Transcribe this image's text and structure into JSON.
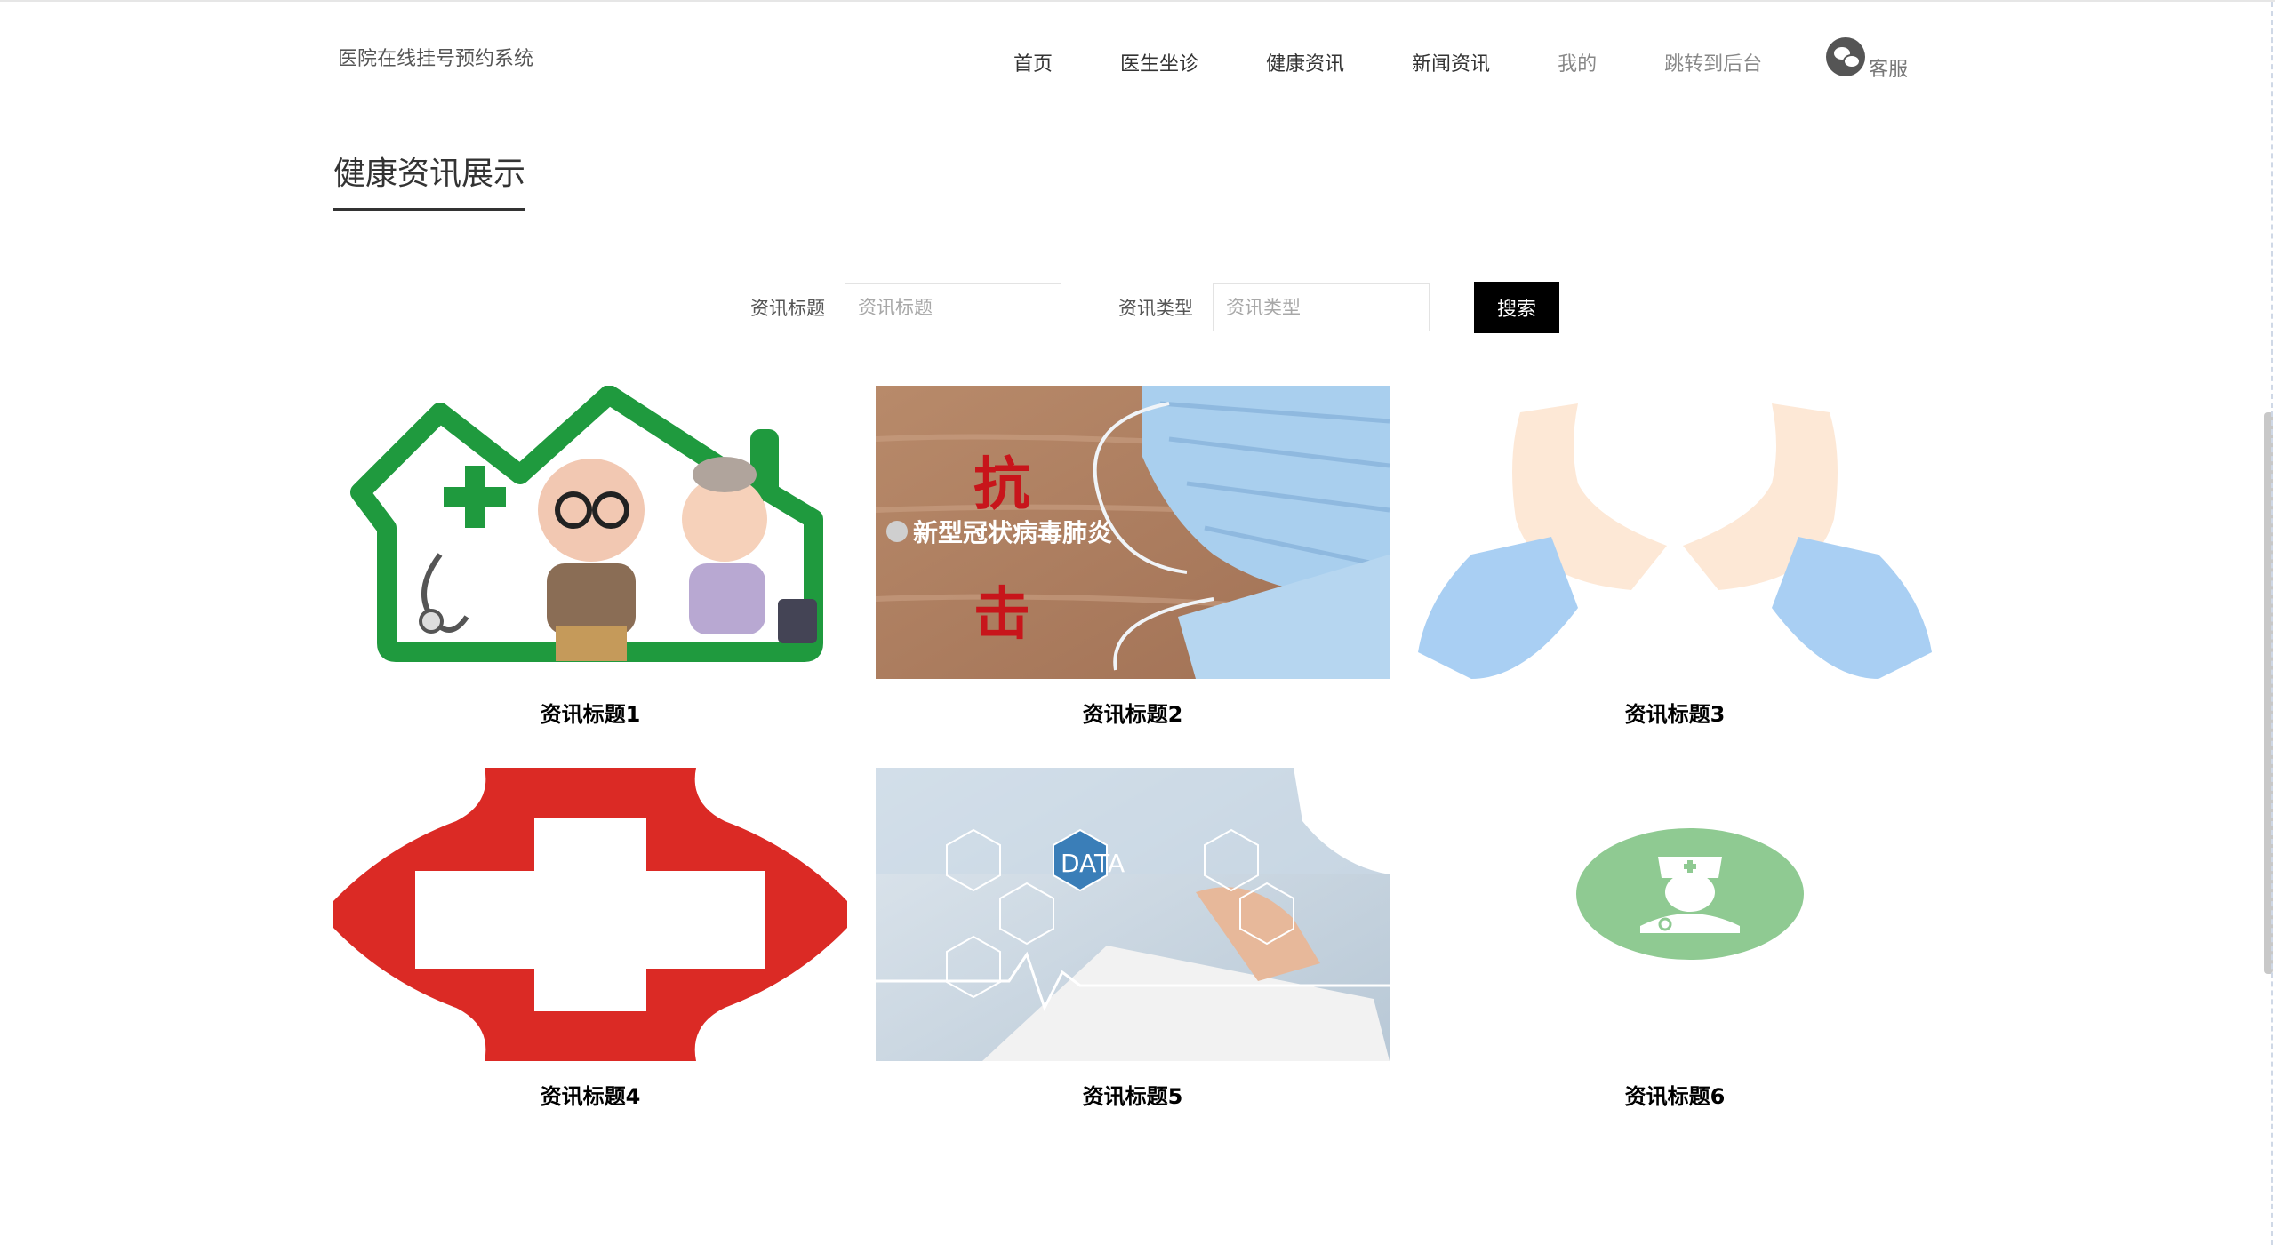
{
  "header": {
    "brand": "医院在线挂号预约系统",
    "nav": [
      {
        "label": "首页"
      },
      {
        "label": "医生坐诊"
      },
      {
        "label": "健康资讯"
      },
      {
        "label": "新闻资讯"
      },
      {
        "label": "我的"
      },
      {
        "label": "跳转到后台"
      }
    ],
    "service": {
      "label": "客服",
      "icon": "wechat-icon"
    }
  },
  "section": {
    "title": "健康资讯展示"
  },
  "search": {
    "title_label": "资讯标题",
    "title_placeholder": "资讯标题",
    "type_label": "资讯类型",
    "type_placeholder": "资讯类型",
    "button_label": "搜索"
  },
  "cards": [
    {
      "title": "资讯标题1",
      "image": "elderly-couple-home-illustration"
    },
    {
      "title": "资讯标题2",
      "image": "face-masks-on-wood",
      "overlay_text": "新型冠状病毒肺炎",
      "overlay_chars": [
        "抗",
        "击"
      ]
    },
    {
      "title": "资讯标题3",
      "image": "hands-heart-illustration"
    },
    {
      "title": "资讯标题4",
      "image": "red-cross-logo"
    },
    {
      "title": "资讯标题5",
      "image": "medical-data-hexagons",
      "overlay_text": "DATA"
    },
    {
      "title": "资讯标题6",
      "image": "doctor-avatar-green"
    }
  ],
  "colors": {
    "accent": "#000000",
    "cross_red": "#db2a25",
    "house_green": "#1f9a3e",
    "avatar_green": "#8fca92"
  }
}
